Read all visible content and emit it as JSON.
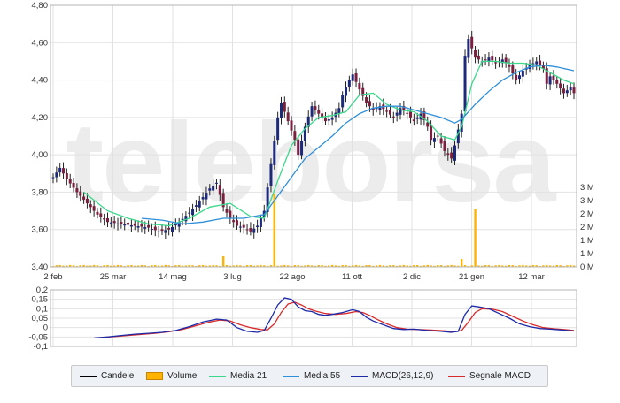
{
  "chart_data": {
    "type": "candlestick",
    "watermark": "teleborsa",
    "price_axis": {
      "ticks": [
        "4,80",
        "4,60",
        "4,40",
        "4,20",
        "4,00",
        "3,80",
        "3,60",
        "3,40"
      ],
      "ylim": [
        3.4,
        4.8
      ]
    },
    "volume_axis": {
      "ticks": [
        "3 M",
        "3 M",
        "2 M",
        "2 M",
        "1 M",
        "1 M",
        "0 M"
      ],
      "ylim": [
        0,
        3000000
      ]
    },
    "macd_axis": {
      "ticks": [
        "0,2",
        "0,15",
        "0,1",
        "0,05",
        "0",
        "-0,05",
        "-0,1"
      ],
      "ylim": [
        -0.1,
        0.2
      ]
    },
    "x_axis": {
      "ticks": [
        "2 feb",
        "25 mar",
        "14 mag",
        "3 lug",
        "22 ago",
        "11 ott",
        "2 dic",
        "21 gen",
        "12 mar"
      ]
    },
    "price_path": [
      [
        0,
        3.88
      ],
      [
        2,
        3.93
      ],
      [
        4,
        3.87
      ],
      [
        7,
        3.8
      ],
      [
        10,
        3.74
      ],
      [
        13,
        3.68
      ],
      [
        16,
        3.64
      ],
      [
        20,
        3.63
      ],
      [
        24,
        3.62
      ],
      [
        28,
        3.61
      ],
      [
        31,
        3.59
      ],
      [
        34,
        3.6
      ],
      [
        37,
        3.64
      ],
      [
        40,
        3.69
      ],
      [
        43,
        3.75
      ],
      [
        46,
        3.82
      ],
      [
        48,
        3.85
      ],
      [
        50,
        3.72
      ],
      [
        52,
        3.66
      ],
      [
        54,
        3.62
      ],
      [
        56,
        3.61
      ],
      [
        58,
        3.59
      ],
      [
        60,
        3.62
      ],
      [
        62,
        3.7
      ],
      [
        64,
        3.95
      ],
      [
        66,
        4.2
      ],
      [
        67,
        4.28
      ],
      [
        69,
        4.18
      ],
      [
        71,
        4.08
      ],
      [
        72,
        4.0
      ],
      [
        74,
        4.15
      ],
      [
        76,
        4.26
      ],
      [
        78,
        4.22
      ],
      [
        80,
        4.18
      ],
      [
        82,
        4.2
      ],
      [
        84,
        4.25
      ],
      [
        85,
        4.32
      ],
      [
        87,
        4.4
      ],
      [
        88,
        4.43
      ],
      [
        90,
        4.35
      ],
      [
        92,
        4.28
      ],
      [
        94,
        4.24
      ],
      [
        96,
        4.26
      ],
      [
        98,
        4.23
      ],
      [
        100,
        4.2
      ],
      [
        102,
        4.25
      ],
      [
        104,
        4.22
      ],
      [
        106,
        4.18
      ],
      [
        108,
        4.22
      ],
      [
        110,
        4.15
      ],
      [
        111,
        4.08
      ],
      [
        113,
        4.1
      ],
      [
        115,
        4.02
      ],
      [
        117,
        3.98
      ],
      [
        118,
        4.05
      ],
      [
        120,
        4.22
      ],
      [
        121,
        4.53
      ],
      [
        122,
        4.62
      ],
      [
        124,
        4.52
      ],
      [
        126,
        4.5
      ],
      [
        128,
        4.52
      ],
      [
        130,
        4.49
      ],
      [
        132,
        4.51
      ],
      [
        134,
        4.47
      ],
      [
        136,
        4.4
      ],
      [
        138,
        4.45
      ],
      [
        140,
        4.48
      ],
      [
        142,
        4.5
      ],
      [
        144,
        4.46
      ],
      [
        145,
        4.38
      ],
      [
        146,
        4.42
      ],
      [
        148,
        4.38
      ],
      [
        150,
        4.33
      ],
      [
        152,
        4.36
      ],
      [
        153,
        4.33
      ]
    ],
    "volume_spikes": [
      {
        "i": 50,
        "value": 400000
      },
      {
        "i": 65,
        "value": 2760000
      },
      {
        "i": 120,
        "value": 300000
      },
      {
        "i": 124,
        "value": 2200000
      }
    ],
    "sma21": [
      [
        9,
        3.8
      ],
      [
        16,
        3.7
      ],
      [
        22,
        3.66
      ],
      [
        28,
        3.63
      ],
      [
        34,
        3.62
      ],
      [
        40,
        3.66
      ],
      [
        46,
        3.72
      ],
      [
        52,
        3.74
      ],
      [
        58,
        3.67
      ],
      [
        62,
        3.66
      ],
      [
        66,
        3.86
      ],
      [
        70,
        4.05
      ],
      [
        74,
        4.14
      ],
      [
        78,
        4.2
      ],
      [
        82,
        4.21
      ],
      [
        86,
        4.23
      ],
      [
        90,
        4.32
      ],
      [
        94,
        4.33
      ],
      [
        98,
        4.27
      ],
      [
        102,
        4.24
      ],
      [
        106,
        4.23
      ],
      [
        110,
        4.18
      ],
      [
        114,
        4.1
      ],
      [
        118,
        4.08
      ],
      [
        120,
        4.15
      ],
      [
        123,
        4.38
      ],
      [
        126,
        4.5
      ],
      [
        130,
        4.5
      ],
      [
        134,
        4.49
      ],
      [
        138,
        4.49
      ],
      [
        142,
        4.48
      ],
      [
        146,
        4.44
      ],
      [
        150,
        4.4
      ],
      [
        153,
        4.38
      ]
    ],
    "sma55": [
      [
        26,
        3.66
      ],
      [
        32,
        3.65
      ],
      [
        38,
        3.63
      ],
      [
        44,
        3.64
      ],
      [
        50,
        3.66
      ],
      [
        56,
        3.66
      ],
      [
        62,
        3.68
      ],
      [
        66,
        3.78
      ],
      [
        70,
        3.88
      ],
      [
        74,
        3.98
      ],
      [
        78,
        4.04
      ],
      [
        82,
        4.1
      ],
      [
        86,
        4.17
      ],
      [
        90,
        4.22
      ],
      [
        94,
        4.25
      ],
      [
        98,
        4.26
      ],
      [
        102,
        4.26
      ],
      [
        106,
        4.24
      ],
      [
        110,
        4.22
      ],
      [
        114,
        4.2
      ],
      [
        118,
        4.17
      ],
      [
        120,
        4.19
      ],
      [
        124,
        4.27
      ],
      [
        128,
        4.34
      ],
      [
        132,
        4.4
      ],
      [
        136,
        4.44
      ],
      [
        140,
        4.47
      ],
      [
        144,
        4.48
      ],
      [
        148,
        4.47
      ],
      [
        153,
        4.45
      ]
    ],
    "macd": [
      [
        12,
        -0.055
      ],
      [
        16,
        -0.05
      ],
      [
        20,
        -0.042
      ],
      [
        24,
        -0.035
      ],
      [
        28,
        -0.03
      ],
      [
        32,
        -0.025
      ],
      [
        36,
        -0.015
      ],
      [
        40,
        0.005
      ],
      [
        44,
        0.03
      ],
      [
        48,
        0.045
      ],
      [
        51,
        0.04
      ],
      [
        54,
        0.0
      ],
      [
        57,
        -0.02
      ],
      [
        60,
        -0.025
      ],
      [
        62,
        -0.015
      ],
      [
        64,
        0.05
      ],
      [
        66,
        0.12
      ],
      [
        68,
        0.158
      ],
      [
        70,
        0.15
      ],
      [
        72,
        0.11
      ],
      [
        74,
        0.09
      ],
      [
        76,
        0.085
      ],
      [
        78,
        0.07
      ],
      [
        80,
        0.065
      ],
      [
        82,
        0.07
      ],
      [
        85,
        0.08
      ],
      [
        88,
        0.095
      ],
      [
        90,
        0.085
      ],
      [
        92,
        0.055
      ],
      [
        94,
        0.035
      ],
      [
        97,
        0.015
      ],
      [
        100,
        -0.005
      ],
      [
        103,
        -0.01
      ],
      [
        106,
        -0.008
      ],
      [
        110,
        -0.015
      ],
      [
        114,
        -0.02
      ],
      [
        117,
        -0.025
      ],
      [
        119,
        -0.02
      ],
      [
        121,
        0.07
      ],
      [
        123,
        0.115
      ],
      [
        125,
        0.11
      ],
      [
        128,
        0.1
      ],
      [
        131,
        0.075
      ],
      [
        134,
        0.05
      ],
      [
        137,
        0.02
      ],
      [
        140,
        0.005
      ],
      [
        143,
        -0.005
      ],
      [
        146,
        -0.008
      ],
      [
        149,
        -0.012
      ],
      [
        153,
        -0.018
      ]
    ],
    "macd_signal": [
      [
        14,
        -0.052
      ],
      [
        18,
        -0.048
      ],
      [
        22,
        -0.042
      ],
      [
        26,
        -0.036
      ],
      [
        30,
        -0.03
      ],
      [
        34,
        -0.022
      ],
      [
        38,
        -0.01
      ],
      [
        42,
        0.01
      ],
      [
        46,
        0.03
      ],
      [
        49,
        0.04
      ],
      [
        52,
        0.035
      ],
      [
        55,
        0.015
      ],
      [
        58,
        0.0
      ],
      [
        61,
        -0.01
      ],
      [
        63,
        -0.012
      ],
      [
        65,
        0.02
      ],
      [
        67,
        0.08
      ],
      [
        69,
        0.125
      ],
      [
        71,
        0.135
      ],
      [
        73,
        0.12
      ],
      [
        75,
        0.1
      ],
      [
        77,
        0.088
      ],
      [
        80,
        0.075
      ],
      [
        83,
        0.07
      ],
      [
        86,
        0.075
      ],
      [
        89,
        0.085
      ],
      [
        91,
        0.08
      ],
      [
        93,
        0.065
      ],
      [
        95,
        0.045
      ],
      [
        98,
        0.02
      ],
      [
        101,
        0.0
      ],
      [
        104,
        -0.008
      ],
      [
        107,
        -0.01
      ],
      [
        111,
        -0.013
      ],
      [
        115,
        -0.017
      ],
      [
        118,
        -0.022
      ],
      [
        120,
        -0.015
      ],
      [
        122,
        0.03
      ],
      [
        124,
        0.08
      ],
      [
        126,
        0.1
      ],
      [
        129,
        0.098
      ],
      [
        132,
        0.085
      ],
      [
        135,
        0.06
      ],
      [
        138,
        0.035
      ],
      [
        141,
        0.015
      ],
      [
        144,
        0.0
      ],
      [
        147,
        -0.006
      ],
      [
        150,
        -0.01
      ],
      [
        153,
        -0.015
      ]
    ],
    "n_periods": 154,
    "volume_base": 50000,
    "legend": [
      {
        "key": "candles",
        "label": "Candele",
        "color": "#000000",
        "kind": "line"
      },
      {
        "key": "volume",
        "label": "Volume",
        "color": "#ffb300",
        "kind": "box"
      },
      {
        "key": "sma21",
        "label": "Media 21",
        "color": "#3ad88a",
        "kind": "line"
      },
      {
        "key": "sma55",
        "label": "Media 55",
        "color": "#2f8fd8",
        "kind": "line"
      },
      {
        "key": "macd",
        "label": "MACD(26,12,9)",
        "color": "#1d2aa8",
        "kind": "line"
      },
      {
        "key": "signal",
        "label": "Segnale MACD",
        "color": "#d92b2b",
        "kind": "line"
      }
    ],
    "colors": {
      "up": "#1d2a7a",
      "down": "#7a1f3d",
      "wick": "#222222",
      "grid": "#e2e2e2",
      "frame": "#b5b5b5",
      "axis_text": "#333333"
    }
  }
}
